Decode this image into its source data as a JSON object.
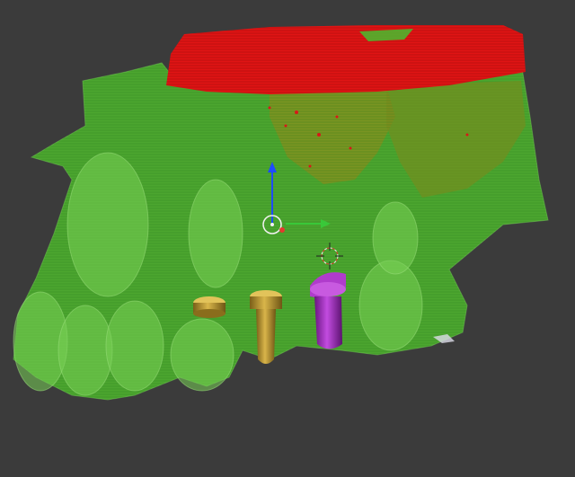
{
  "viewport": {
    "background": "#3b3b3b"
  },
  "scene": {
    "objects": [
      {
        "name": "maxilla-bone-model",
        "color": "#5fc63a"
      },
      {
        "name": "sinus-region-model",
        "color": "#8a8f1f"
      },
      {
        "name": "upper-bone-region-model",
        "color": "#e01414"
      },
      {
        "name": "gold-dental-implant-left",
        "color": "#b8962e"
      },
      {
        "name": "gold-dental-implant-center",
        "color": "#b8962e"
      },
      {
        "name": "purple-dental-implant",
        "color": "#a62fc0"
      }
    ],
    "gizmo": {
      "z_axis_color": "#1e4cff",
      "x_axis_color": "#e33b2e",
      "y_axis_color": "#39c839",
      "pivot_color": "#f2f2f2"
    },
    "cursor": {
      "icon": "3d-cursor-icon",
      "colors": [
        "#e33b2e",
        "#f2f2f2"
      ]
    }
  }
}
